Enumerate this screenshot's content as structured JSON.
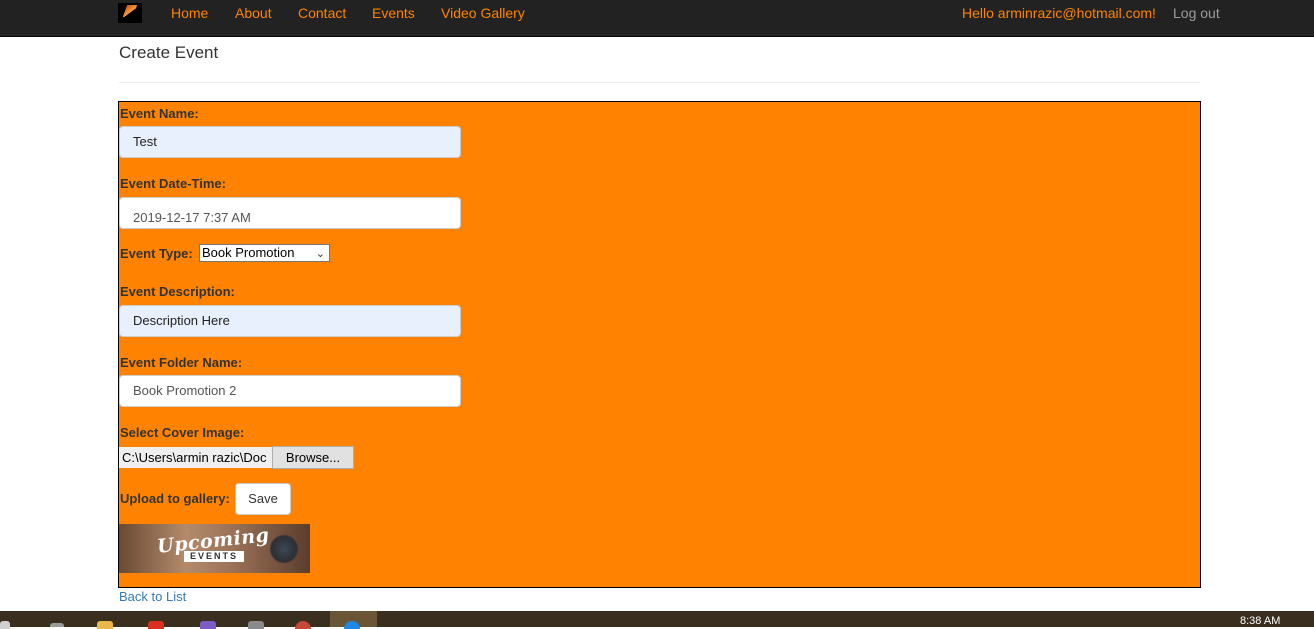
{
  "navbar": {
    "links": [
      "Home",
      "About",
      "Contact",
      "Events",
      "Video Gallery"
    ],
    "user_greeting": "Hello arminrazic@hotmail.com!",
    "logout": "Log out",
    "link_color": "#ff8300"
  },
  "page": {
    "title": "Create Event",
    "back_link": "Back to List"
  },
  "form": {
    "panel_color": "#ff8300",
    "event_name_label": "Event Name:",
    "event_name_value": "Test",
    "event_datetime_label": "Event Date-Time:",
    "event_datetime_value": "2019-12-17 7:37 AM",
    "event_type_label": "Event Type:",
    "event_type_selected": "Book Promotion",
    "event_description_label": "Event Description:",
    "event_description_value": "Description Here",
    "event_folder_label": "Event Folder Name:",
    "event_folder_value": "Book Promotion 2",
    "cover_image_label": "Select Cover Image:",
    "cover_image_path": "C:\\Users\\armin razic\\Doc",
    "browse_label": "Browse...",
    "upload_label": "Upload to gallery:",
    "save_label": "Save"
  },
  "cover_preview": {
    "title": "Upcoming",
    "subtitle": "EVENTS"
  },
  "taskbar": {
    "clock": "8:38 AM"
  }
}
